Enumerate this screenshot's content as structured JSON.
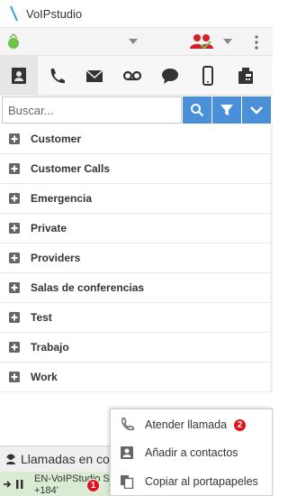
{
  "window": {
    "title": "VoIPstudio"
  },
  "toolbar": {
    "status_color": "#6cc24a",
    "people_color": "#d0202a"
  },
  "tabs": [
    {
      "name": "contacts",
      "icon": "address-book-icon",
      "active": true
    },
    {
      "name": "calls",
      "icon": "phone-icon"
    },
    {
      "name": "messages",
      "icon": "envelope-icon"
    },
    {
      "name": "voicemail",
      "icon": "voicemail-icon"
    },
    {
      "name": "chat",
      "icon": "chat-bubble-icon"
    },
    {
      "name": "mobile",
      "icon": "mobile-icon"
    },
    {
      "name": "fax",
      "icon": "fax-icon"
    }
  ],
  "search": {
    "placeholder": "Buscar..."
  },
  "groups": [
    "Customer",
    "Customer Calls",
    "Emergencia",
    "Private",
    "Providers",
    "Salas de conferencias",
    "Test",
    "Trabajo",
    "Work"
  ],
  "calls_panel": {
    "header": "Llamadas en co",
    "call": {
      "name": "EN-VoIPStudio Su",
      "number": "+184'",
      "badge": "1"
    }
  },
  "context_menu": {
    "items": [
      {
        "label": "Atender llamada",
        "badge": "2",
        "icon": "phone-icon"
      },
      {
        "label": "Añadir a contactos",
        "icon": "contact-card-icon"
      },
      {
        "label": "Copiar al portapapeles",
        "icon": "copy-icon"
      }
    ]
  },
  "colors": {
    "accent": "#4a90d9",
    "call_row": "#d9ecd3",
    "badge": "#e3101a"
  }
}
